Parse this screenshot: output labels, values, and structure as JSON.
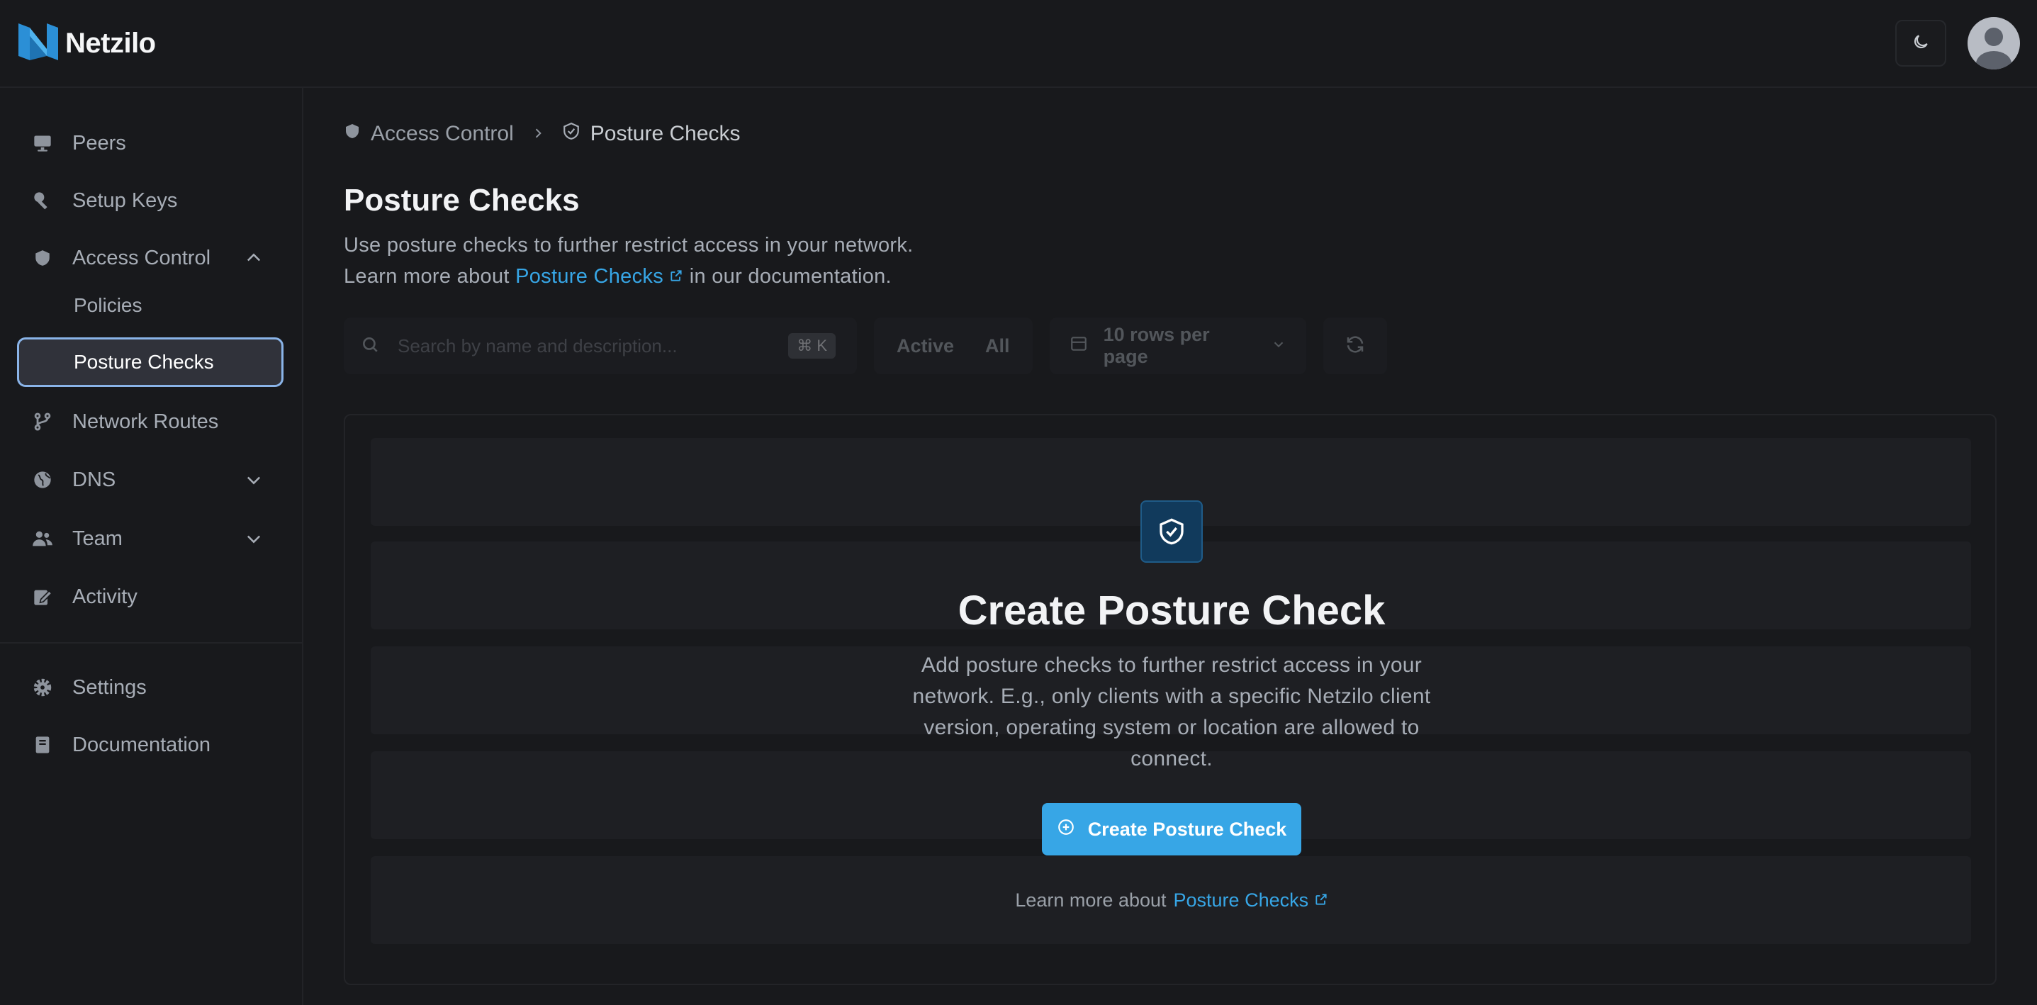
{
  "app": {
    "name": "Netzilo"
  },
  "sidebar": {
    "items": [
      {
        "label": "Peers"
      },
      {
        "label": "Setup Keys"
      },
      {
        "label": "Access Control"
      },
      {
        "label": "Policies"
      },
      {
        "label": "Posture Checks"
      },
      {
        "label": "Network Routes"
      },
      {
        "label": "DNS"
      },
      {
        "label": "Team"
      },
      {
        "label": "Activity"
      },
      {
        "label": "Settings"
      },
      {
        "label": "Documentation"
      }
    ]
  },
  "breadcrumb": {
    "parent": "Access Control",
    "current": "Posture Checks"
  },
  "page": {
    "title": "Posture Checks",
    "desc_line1": "Use posture checks to further restrict access in your network.",
    "desc_prefix": "Learn more about",
    "desc_link": "Posture Checks",
    "desc_suffix": "in our documentation."
  },
  "toolbar": {
    "search_placeholder": "Search by name and description...",
    "shortcut": "⌘ K",
    "filter_active": "Active",
    "filter_all": "All",
    "rows_per_page": "10 rows per page"
  },
  "empty_state": {
    "title": "Create Posture Check",
    "description": "Add posture checks to further restrict access in your network. E.g., only clients with a specific Netzilo client version, operating system or location are allowed to connect.",
    "button": "Create Posture Check",
    "learn_prefix": "Learn more about",
    "learn_link": "Posture Checks"
  },
  "colors": {
    "accent": "#37a6e6",
    "background": "#18191c",
    "active_border": "#8ab4e8"
  }
}
